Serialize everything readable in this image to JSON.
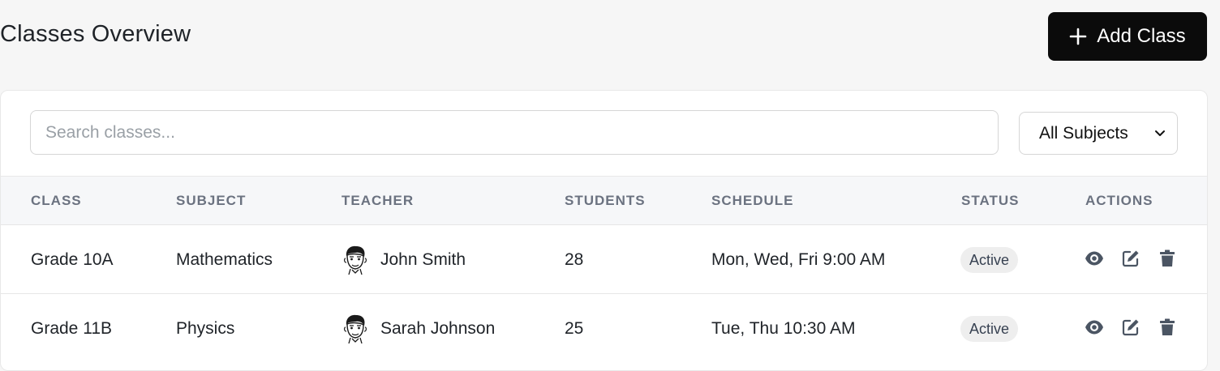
{
  "header": {
    "title": "Classes Overview",
    "add_button_label": "Add Class"
  },
  "filters": {
    "search_placeholder": "Search classes...",
    "search_value": "",
    "subject_select": "All Subjects"
  },
  "table": {
    "columns": [
      "CLASS",
      "SUBJECT",
      "TEACHER",
      "STUDENTS",
      "SCHEDULE",
      "STATUS",
      "ACTIONS"
    ],
    "rows": [
      {
        "class": "Grade 10A",
        "subject": "Mathematics",
        "teacher": "John Smith",
        "students": "28",
        "schedule": "Mon, Wed, Fri 9:00 AM",
        "status": "Active"
      },
      {
        "class": "Grade 11B",
        "subject": "Physics",
        "teacher": "Sarah Johnson",
        "students": "25",
        "schedule": "Tue, Thu 10:30 AM",
        "status": "Active"
      }
    ],
    "action_icons": [
      "eye-icon",
      "edit-icon",
      "trash-icon"
    ]
  },
  "colors": {
    "primary_button": "#0b0b0b",
    "badge_bg": "#eeeeee",
    "header_text": "#6b7280",
    "action_icon": "#4b5563"
  }
}
